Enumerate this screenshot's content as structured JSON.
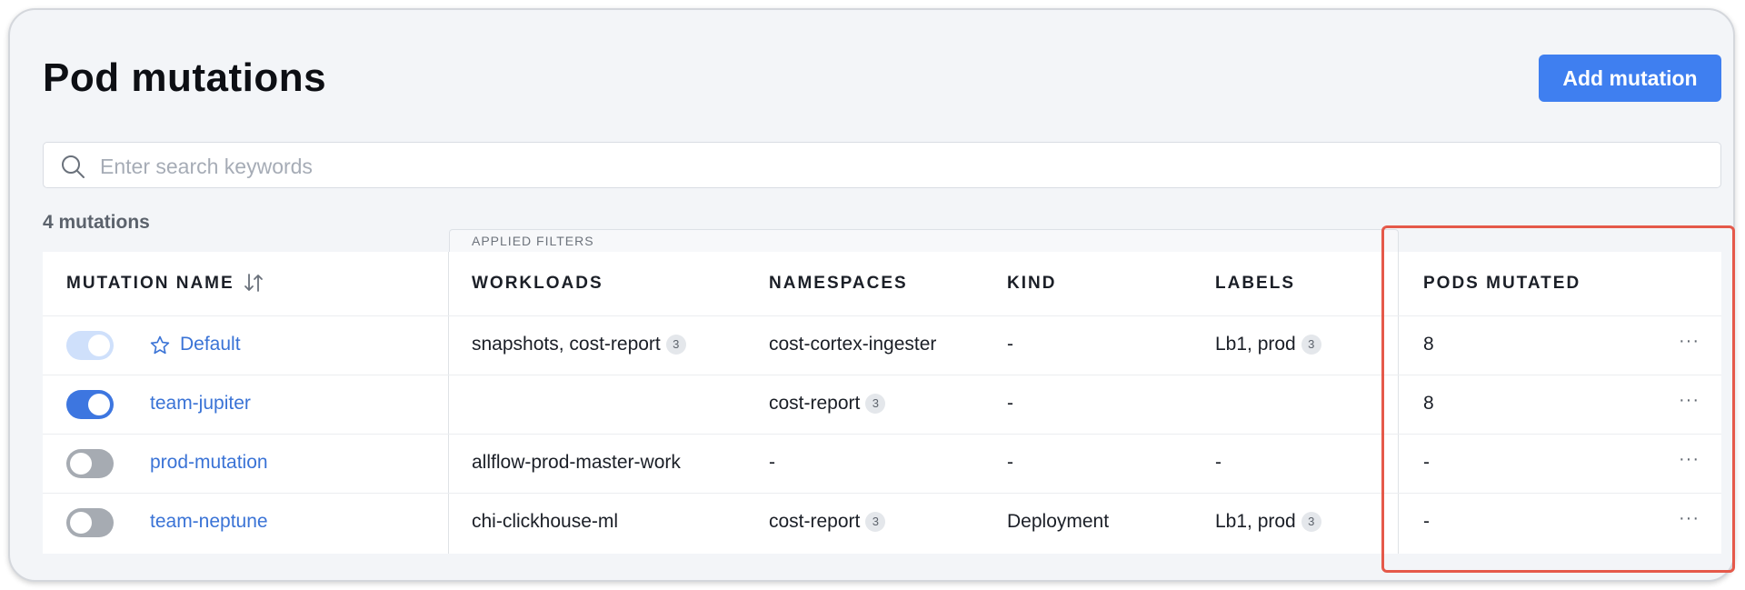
{
  "header": {
    "title": "Pod mutations",
    "add_button_label": "Add mutation"
  },
  "search": {
    "placeholder": "Enter search keywords",
    "value": ""
  },
  "summary": {
    "count_label": "4 mutations"
  },
  "applied_filters_label": "APPLIED FILTERS",
  "table": {
    "columns": {
      "mutation_name": "MUTATION NAME",
      "workloads": "WORKLOADS",
      "namespaces": "NAMESPACES",
      "kind": "KIND",
      "labels": "LABELS",
      "pods_mutated": "PODS MUTATED"
    },
    "rows": [
      {
        "toggle": "on-disabled",
        "default": true,
        "name": "Default",
        "workloads": "snapshots, cost-report",
        "workloads_badge": "3",
        "namespaces": "cost-cortex-ingester",
        "namespaces_badge": "",
        "kind": "-",
        "labels": "Lb1, prod",
        "labels_badge": "3",
        "pods_mutated": "8",
        "more": "···"
      },
      {
        "toggle": "on",
        "default": false,
        "name": "team-jupiter",
        "workloads": "",
        "workloads_badge": "",
        "namespaces": "cost-report",
        "namespaces_badge": "3",
        "kind": "-",
        "labels": "",
        "labels_badge": "",
        "pods_mutated": "8",
        "more": "···"
      },
      {
        "toggle": "off",
        "default": false,
        "name": "prod-mutation",
        "workloads": "allflow-prod-master-work",
        "workloads_badge": "",
        "namespaces": "-",
        "namespaces_badge": "",
        "kind": "-",
        "labels": "-",
        "labels_badge": "",
        "pods_mutated": "-",
        "more": "···"
      },
      {
        "toggle": "off",
        "default": false,
        "name": "team-neptune",
        "workloads": "chi-clickhouse-ml",
        "workloads_badge": "",
        "namespaces": "cost-report",
        "namespaces_badge": "3",
        "kind": "Deployment",
        "labels": "Lb1, prod",
        "labels_badge": "3",
        "pods_mutated": "-",
        "more": "···"
      }
    ]
  },
  "colors": {
    "accent": "#3f7ff0",
    "link": "#3a73d6",
    "highlight_outline": "#e5594a",
    "background": "#f3f5f8"
  },
  "icons": [
    "search-icon",
    "sort-icon",
    "star-icon",
    "more-icon"
  ]
}
